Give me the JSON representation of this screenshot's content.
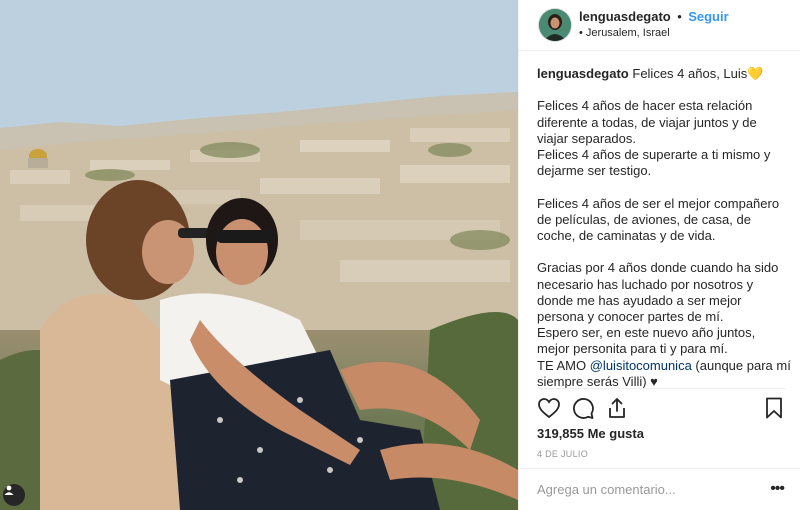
{
  "header": {
    "username": "lenguasdegato",
    "separator": "•",
    "follow_label": "Seguir",
    "location": "• Jerusalem, Israel"
  },
  "caption": {
    "username": "lenguasdegato",
    "title_text": "Felices 4 años, Luis💛",
    "paragraph1": [
      "Felices 4 años de hacer esta relación",
      "diferente a todas, de viajar juntos y de",
      "viajar separados.",
      "Felices 4 años de superarte a ti mismo y",
      "dejarme ser testigo."
    ],
    "paragraph2": [
      "Felices 4 años de ser el mejor compañero",
      "de películas, de aviones, de casa, de",
      "coche, de caminatas y de vida."
    ],
    "paragraph3": [
      "Gracias por 4 años donde cuando ha sido",
      "necesario has luchado por nosotros y",
      "donde me has ayudado a ser mejor",
      "persona y conocer partes de mí.",
      "Espero ser, en este nuevo año juntos,",
      "mejor personita para ti y para mí."
    ],
    "love_prefix": "TE AMO ",
    "mention": "@luisitocomunica",
    "love_suffix": " (aunque para mí",
    "last_line": "siempre serás Villi) ♥"
  },
  "actions": {
    "icons": [
      "heart-icon",
      "comment-icon",
      "share-icon",
      "bookmark-icon"
    ]
  },
  "likes_text": "319,855 Me gusta",
  "date_text": "4 DE JULIO",
  "comment_placeholder": "Agrega un comentario...",
  "more_label": "•••",
  "colors": {
    "link": "#3897f0",
    "mention": "#003569",
    "text": "#262626",
    "muted": "#999999"
  }
}
